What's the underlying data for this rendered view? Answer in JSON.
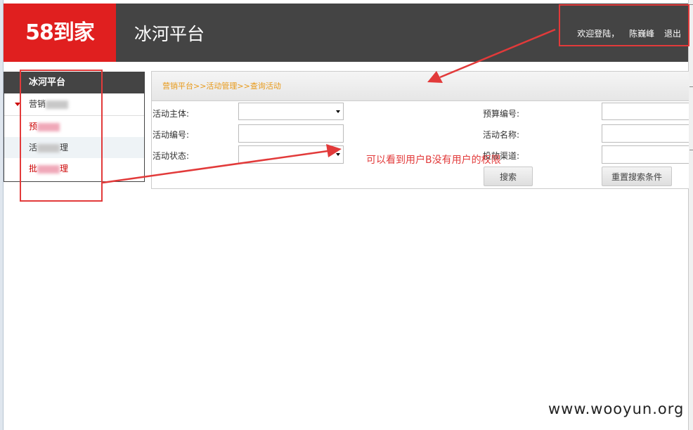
{
  "header": {
    "logo": "58到家",
    "platform_title": "冰河平台",
    "welcome": "欢迎登陆，",
    "username": "陈巍峰",
    "logout": "退出"
  },
  "sidebar": {
    "title": "冰河平台",
    "section": "营销",
    "items": [
      {
        "prefix": "预",
        "suffix": ""
      },
      {
        "prefix": "活",
        "suffix": "理"
      },
      {
        "prefix": "批",
        "suffix": "理"
      }
    ]
  },
  "main": {
    "breadcrumb": "营销平台>>活动管理>>查询活动",
    "form": {
      "subject_label": "活动主体:",
      "budget_no_label": "预算编号:",
      "activity_no_label": "活动编号:",
      "activity_name_label": "活动名称:",
      "activity_status_label": "活动状态:",
      "channel_label": "投放渠道:"
    },
    "search_button": "搜索",
    "reset_button": "重置搜索条件"
  },
  "annotation": {
    "text": "可以看到用户B没有用户的权限",
    "color": "#e23a3a"
  },
  "watermark": "www.wooyun.org",
  "colors": {
    "brand_red": "#e01f1f",
    "header_bg": "#444444",
    "breadcrumb": "#e89a1a"
  }
}
